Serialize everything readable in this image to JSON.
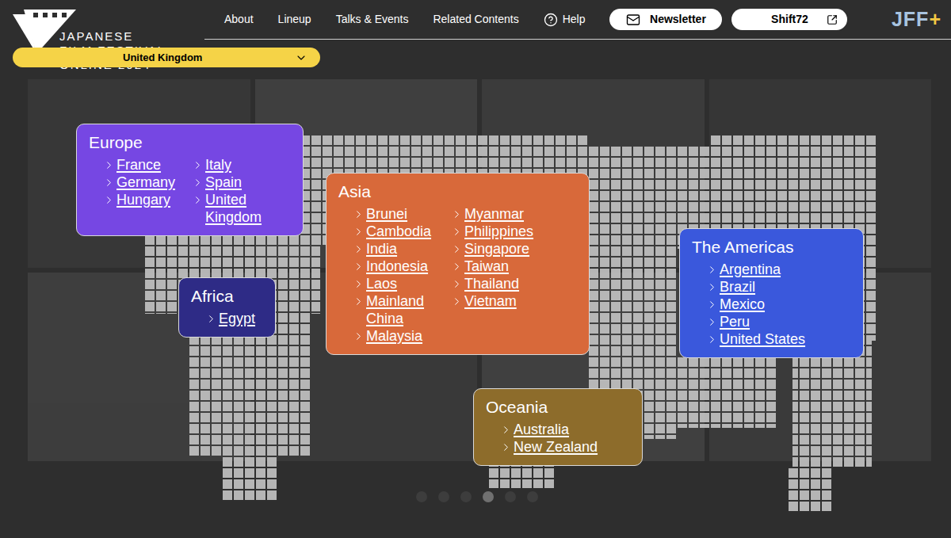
{
  "logo": {
    "lines": [
      "JAPANESE",
      "FILM FESTIVAL",
      "ONLINE 2024"
    ]
  },
  "region_select": {
    "value": "United Kingdom"
  },
  "nav": {
    "items": [
      {
        "label": "About",
        "kind": "link"
      },
      {
        "label": "Lineup",
        "kind": "link"
      },
      {
        "label": "Talks & Events",
        "kind": "link"
      },
      {
        "label": "Related Contents",
        "kind": "link"
      },
      {
        "label": "Help",
        "kind": "help"
      }
    ]
  },
  "newsletter_button": {
    "label": "Newsletter"
  },
  "shift72_button": {
    "label": "Shift72"
  },
  "partner_logo": {
    "letters": "JFF",
    "plus": "+"
  },
  "regions": [
    {
      "name": "Europe",
      "color": "#7647e3",
      "columns": [
        [
          "France",
          "Germany",
          "Hungary"
        ],
        [
          "Italy",
          "Spain",
          "United Kingdom"
        ]
      ]
    },
    {
      "name": "Africa",
      "color": "#2e2b86",
      "columns": [
        [
          "Egypt"
        ]
      ]
    },
    {
      "name": "Asia",
      "color": "#d8693a",
      "columns": [
        [
          "Brunei",
          "Cambodia",
          "India",
          "Indonesia",
          "Laos",
          "Mainland China",
          "Malaysia"
        ],
        [
          "Myanmar",
          "Philippines",
          "Singapore",
          "Taiwan",
          "Thailand",
          "Vietnam"
        ]
      ]
    },
    {
      "name": "The Americas",
      "color": "#3a58dc",
      "columns": [
        [
          "Argentina",
          "Brazil",
          "Mexico",
          "Peru",
          "United States"
        ]
      ]
    },
    {
      "name": "Oceania",
      "color": "#8d6c2b",
      "columns": [
        [
          "Australia",
          "New Zealand"
        ]
      ]
    }
  ],
  "carousel": {
    "dots": [
      {
        "selected": false
      },
      {
        "selected": false
      },
      {
        "selected": false
      },
      {
        "selected": true
      },
      {
        "selected": false
      },
      {
        "selected": false
      }
    ]
  }
}
